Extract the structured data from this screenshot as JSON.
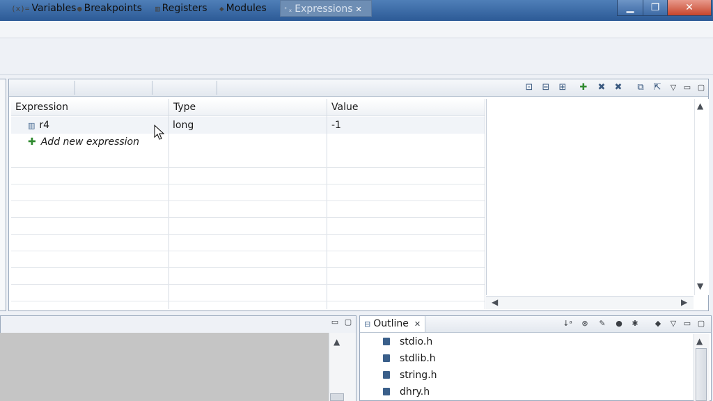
{
  "window": {
    "minimize": "▁",
    "maximize": "❐",
    "close": "✕"
  },
  "tabs": {
    "variables": "Variables",
    "breakpoints": "Breakpoints",
    "registers": "Registers",
    "modules": "Modules",
    "expressions": "Expressions"
  },
  "table": {
    "headers": [
      "Expression",
      "Type",
      "Value"
    ],
    "rows": [
      {
        "expression": "r4",
        "type": "long",
        "value": "-1"
      }
    ],
    "add_new": "Add new expression"
  },
  "outline": {
    "tab_label": "Outline",
    "items": [
      "stdio.h",
      "stdlib.h",
      "string.h",
      "dhry.h"
    ]
  },
  "icons": {
    "variables": "variables-icon",
    "breakpoints": "breakpoints-icon",
    "registers": "registers-icon",
    "modules": "modules-icon",
    "expressions": "expressions-icon",
    "add": "plus-icon",
    "remove": "x-icon"
  },
  "colors": {
    "title_bar": "#3a6aa8",
    "active_tab": "#6e8eb4",
    "add_icon": "#2f8a2f"
  }
}
